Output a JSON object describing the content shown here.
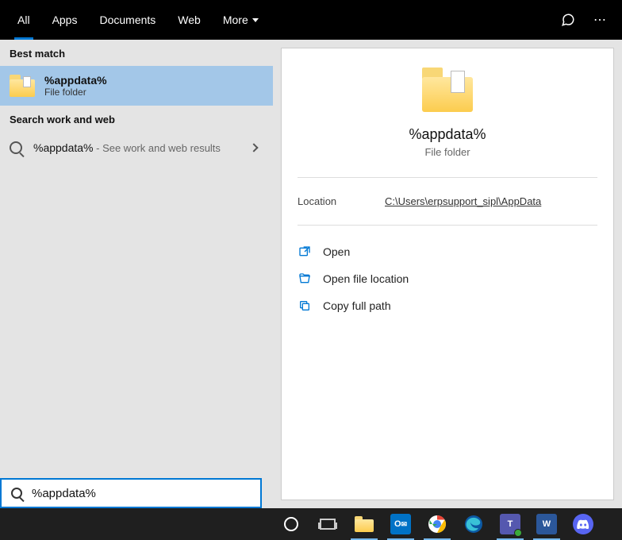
{
  "tabs": {
    "all": "All",
    "apps": "Apps",
    "documents": "Documents",
    "web": "Web",
    "more": "More"
  },
  "left": {
    "best_match_header": "Best match",
    "best_match": {
      "title": "%appdata%",
      "subtitle": "File folder"
    },
    "search_web_header": "Search work and web",
    "web_item": {
      "query": "%appdata%",
      "hint": " - See work and web results"
    }
  },
  "preview": {
    "title": "%appdata%",
    "subtitle": "File folder",
    "location_label": "Location",
    "location_value": "C:\\Users\\erpsupport_sipl\\AppData",
    "actions": {
      "open": "Open",
      "open_location": "Open file location",
      "copy_path": "Copy full path"
    }
  },
  "searchbox": {
    "value": "%appdata%"
  },
  "taskbar": {
    "outlook": "O",
    "teams": "T",
    "word": "W"
  }
}
